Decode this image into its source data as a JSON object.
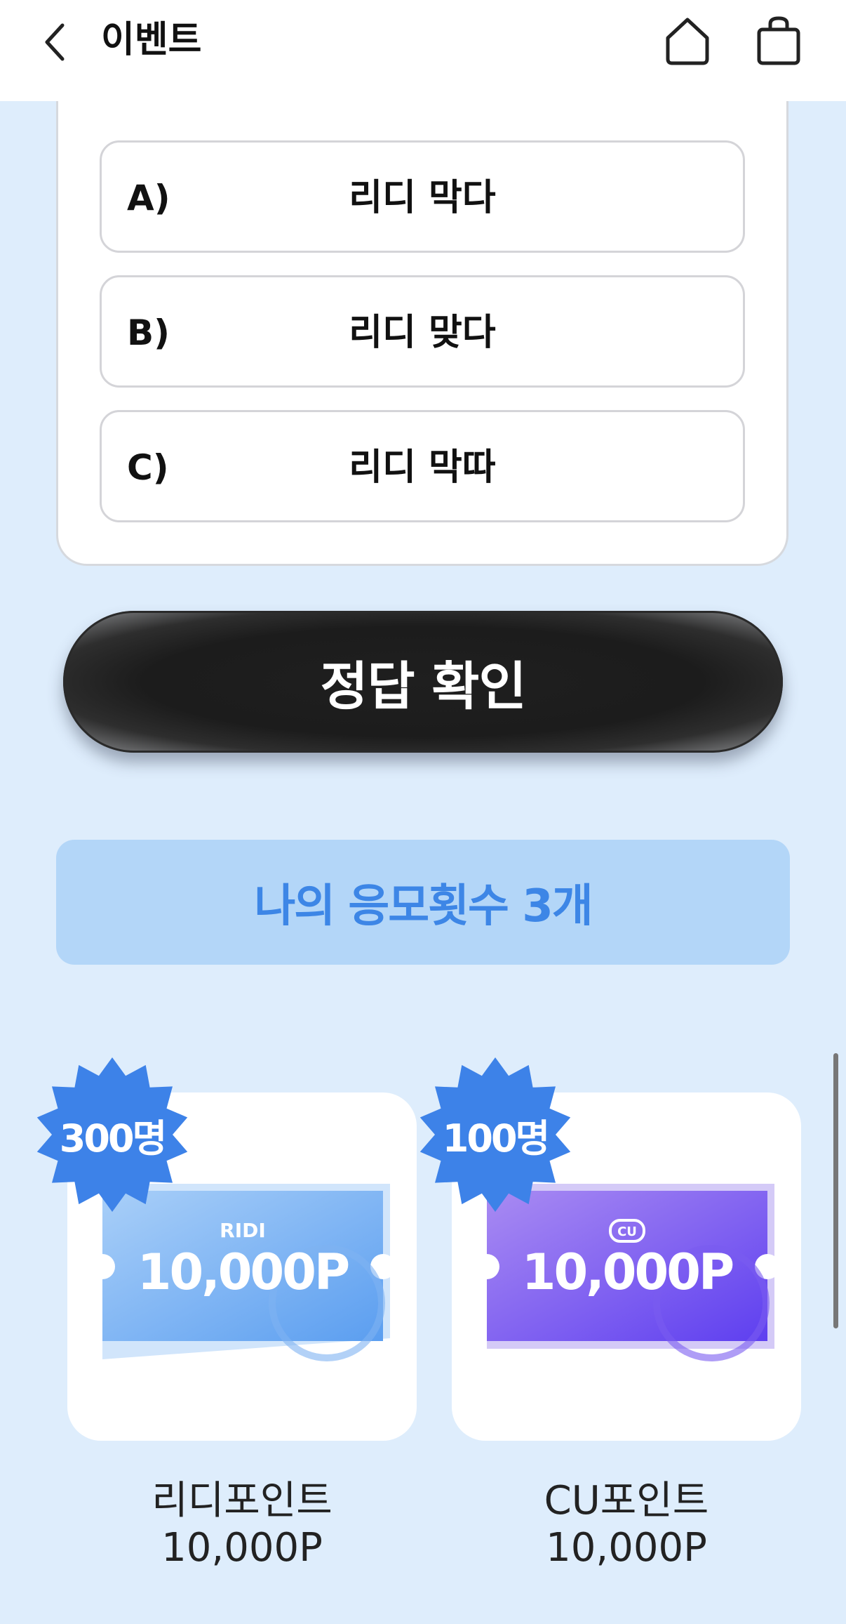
{
  "header": {
    "title": "이벤트",
    "back_icon": "chevron-left-icon",
    "home_icon": "home-icon",
    "cart_icon": "shopping-bag-icon"
  },
  "quiz": {
    "options": [
      {
        "letter": "A)",
        "text": "리디 막다"
      },
      {
        "letter": "B)",
        "text": "리디 맞다"
      },
      {
        "letter": "C)",
        "text": "리디 막따"
      }
    ]
  },
  "submit": {
    "label": "정답 확인"
  },
  "entries": {
    "label": "나의 응모횟수 3개"
  },
  "rewards": [
    {
      "badge": "300명",
      "brand": "RIDI",
      "ticket_value": "10,000P",
      "name": "리디포인트",
      "amount": "10,000P",
      "color_light": "#a9cff8",
      "color_dark": "#5b9ef0"
    },
    {
      "badge": "100명",
      "brand": "CU",
      "ticket_value": "10,000P",
      "name": "CU포인트",
      "amount": "10,000P",
      "color_light": "#a98bf2",
      "color_dark": "#5e3ff0"
    }
  ],
  "colors": {
    "background": "#deedfc",
    "badge": "#3d82e8",
    "entries_bg": "#b3d6f8",
    "entries_text": "#3d86e6"
  }
}
